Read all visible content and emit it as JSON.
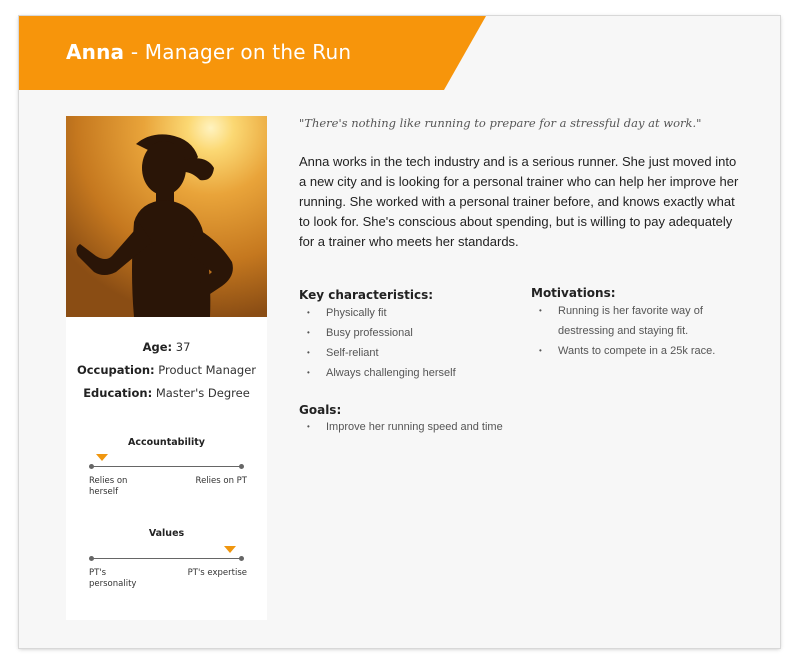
{
  "persona": {
    "name": "Anna",
    "title_suffix": " - Manager on the Run",
    "quote": "\"There's nothing like running to prepare for a stressful day at work.\"",
    "bio": "Anna works in the tech industry and is a serious runner. She just moved into a new city and is looking for a personal trainer who can help her improve her running. She worked with a personal trainer before, and knows exactly what to look for. She's conscious about spending, but is willing to pay adequately for a trainer who meets her standards."
  },
  "profile": {
    "age_label": "Age:",
    "age_value": " 37",
    "occupation_label": "Occupation:",
    "occupation_value": " Product Manager",
    "education_label": "Education:",
    "education_value": " Master's Degree"
  },
  "scales": [
    {
      "title": "Accountability",
      "left_label": "Relies on herself",
      "right_label": "Relies on PT",
      "position": 0.07
    },
    {
      "title": "Values",
      "left_label": "PT's personality",
      "right_label": "PT's expertise",
      "position": 0.92
    }
  ],
  "key_characteristics": {
    "heading": "Key characteristics:",
    "items": [
      "Physically fit",
      "Busy professional",
      "Self-reliant",
      "Always challenging herself"
    ]
  },
  "goals": {
    "heading": "Goals:",
    "items": [
      "Improve her running speed and time"
    ]
  },
  "motivations": {
    "heading": "Motivations:",
    "items": [
      "Running is her favorite way of destressing and staying fit.",
      "Wants to compete in a 25k race."
    ]
  },
  "colors": {
    "accent": "#f7950b",
    "marker": "#f0960e"
  }
}
